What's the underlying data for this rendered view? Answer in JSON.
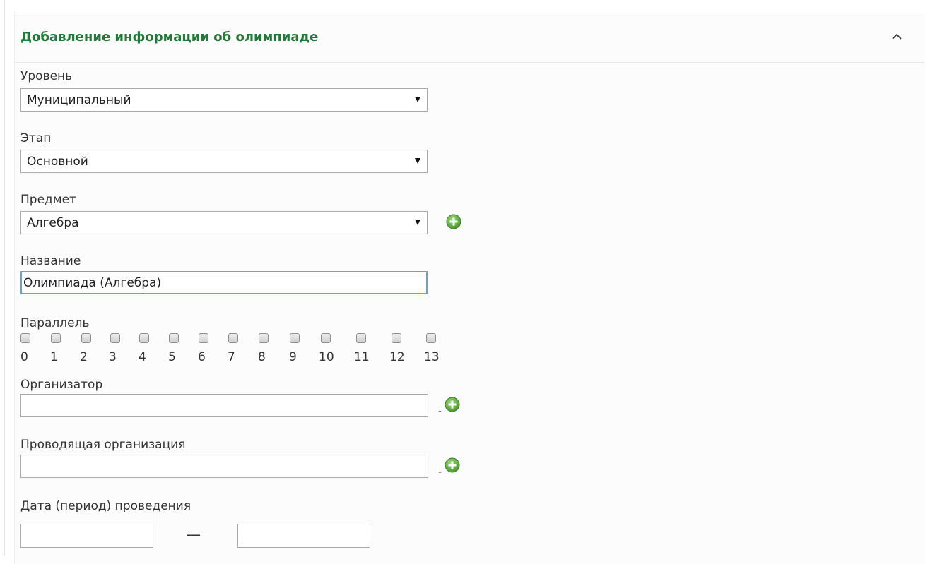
{
  "panel": {
    "title": "Добавление информации об олимпиаде"
  },
  "fields": {
    "level": {
      "label": "Уровень",
      "value": "Муниципальный"
    },
    "stage": {
      "label": "Этап",
      "value": "Основной"
    },
    "subject": {
      "label": "Предмет",
      "value": "Алгебра"
    },
    "name": {
      "label": "Название",
      "value": "Олимпиада (Алгебра)"
    },
    "grades": {
      "label": "Параллель",
      "options": [
        "0",
        "1",
        "2",
        "3",
        "4",
        "5",
        "6",
        "7",
        "8",
        "9",
        "10",
        "11",
        "12",
        "13"
      ]
    },
    "organizer": {
      "label": "Организатор",
      "value": "",
      "suffix": "-"
    },
    "host_org": {
      "label": "Проводящая организация",
      "value": "",
      "suffix": "-"
    },
    "date": {
      "label": "Дата (период) проведения",
      "from": "",
      "to": "",
      "separator": "—"
    }
  },
  "icons": {
    "collapse": "chevron-up-icon",
    "add": "plus-circle-icon"
  },
  "colors": {
    "title": "#217a3a",
    "add_button": "#5aa83c",
    "focus_border": "#6a9fd8"
  }
}
